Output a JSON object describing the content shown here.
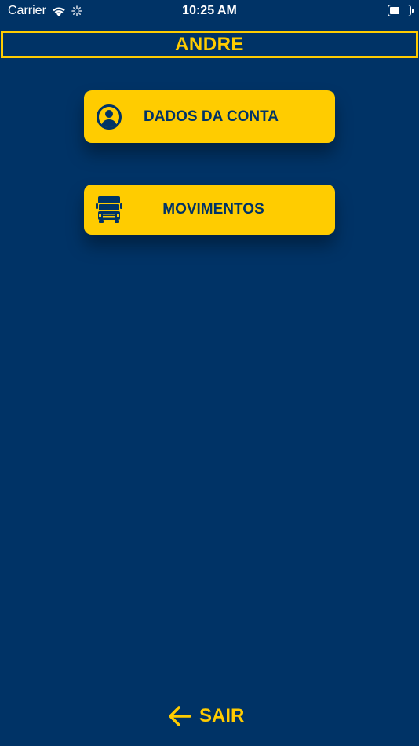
{
  "status_bar": {
    "carrier": "Carrier",
    "time": "10:25 AM",
    "icons": [
      "wifi-icon",
      "loading-spinner-icon",
      "battery-icon"
    ]
  },
  "header": {
    "title": "ANDRE"
  },
  "menu": {
    "items": [
      {
        "label": "DADOS DA CONTA",
        "icon": "user-circle-icon"
      },
      {
        "label": "MOVIMENTOS",
        "icon": "truck-icon"
      }
    ]
  },
  "footer": {
    "exit_label": "SAIR",
    "exit_icon": "arrow-left-icon"
  },
  "colors": {
    "background": "#003366",
    "accent": "#ffcc00",
    "text_dark": "#003366"
  }
}
